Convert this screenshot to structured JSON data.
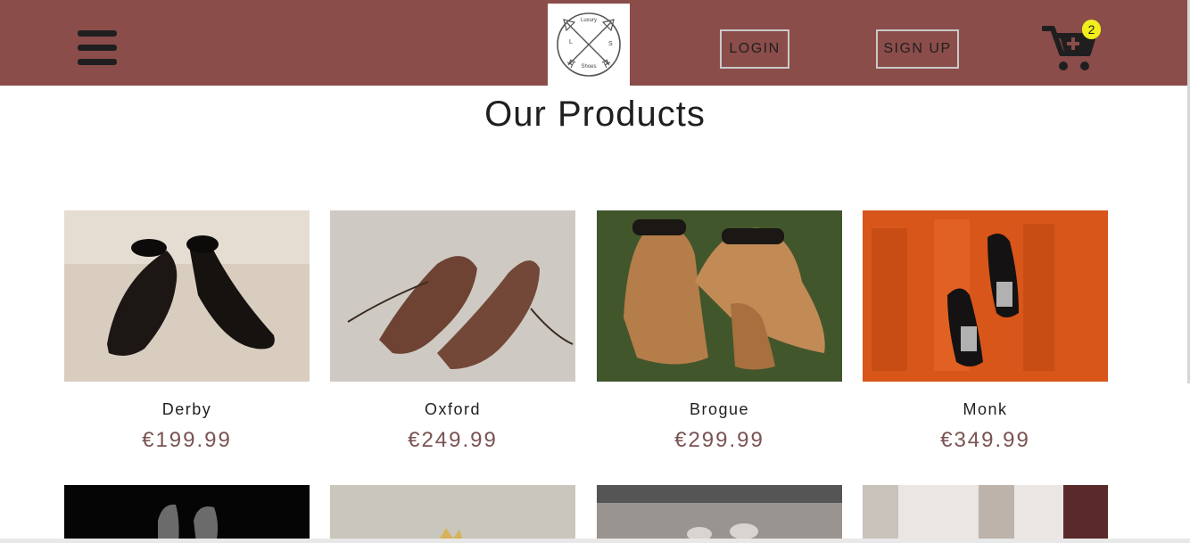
{
  "header": {
    "logo": {
      "text_top": "Luxury",
      "text_left": "L",
      "text_right": "S",
      "text_bottom": "Shoes"
    },
    "login_label": "LOGIN",
    "signup_label": "SIGN UP",
    "cart_count": "2",
    "icons": {
      "menu": "hamburger-menu-icon",
      "cart": "cart-plus-icon"
    },
    "colors": {
      "header_bg": "#8b4d4a",
      "badge": "#f1ef1a"
    }
  },
  "main": {
    "title": "Our Products",
    "products": [
      {
        "name": "Derby",
        "price": "€199.99"
      },
      {
        "name": "Oxford",
        "price": "€249.99"
      },
      {
        "name": "Brogue",
        "price": "€299.99"
      },
      {
        "name": "Monk",
        "price": "€349.99"
      }
    ],
    "colors": {
      "price": "#7a5352"
    }
  }
}
